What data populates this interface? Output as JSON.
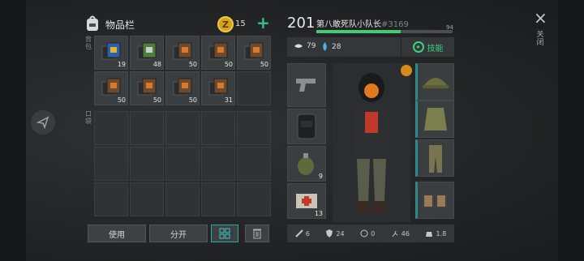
{
  "inventory": {
    "title": "物品栏",
    "coins": "15",
    "side_label_backpack": "背包",
    "side_label_pockets": "口袋",
    "slots": [
      {
        "qty": "19",
        "icon": "blue-book-icon"
      },
      {
        "qty": "48",
        "icon": "green-book-icon"
      },
      {
        "qty": "50",
        "icon": "book-icon"
      },
      {
        "qty": "50",
        "icon": "book-icon"
      },
      {
        "qty": "50",
        "icon": "book-icon"
      },
      {
        "qty": "50",
        "icon": "book-icon"
      },
      {
        "qty": "50",
        "icon": "book-icon"
      },
      {
        "qty": "50",
        "icon": "book-icon"
      },
      {
        "qty": "31",
        "icon": "book-icon"
      },
      {
        "qty": "",
        "icon": ""
      }
    ],
    "buttons": {
      "use": "使用",
      "split": "分开"
    }
  },
  "character": {
    "level": "201",
    "rank": "第八敢死队小队长",
    "rank_id": "#3169",
    "xp_value": "94",
    "xp_fraction": 0.62,
    "food": "79",
    "water": "28",
    "skill_label": "技能",
    "skill_badge": "★",
    "equipment": {
      "pistol": "",
      "backpack": "",
      "grenade": "9",
      "medkit": "13"
    },
    "armor_slots": [
      "hat-icon",
      "vest-icon",
      "pants-icon",
      "boots-icon"
    ],
    "bottom_stats": {
      "damage": "6",
      "defense": "24",
      "toxic": "0",
      "speed": "46",
      "weight": "1.8"
    }
  },
  "window": {
    "close_icon": "×",
    "close_label": "关闭"
  },
  "colors": {
    "accent": "#3fcf73",
    "coin": "#d6a21c"
  }
}
